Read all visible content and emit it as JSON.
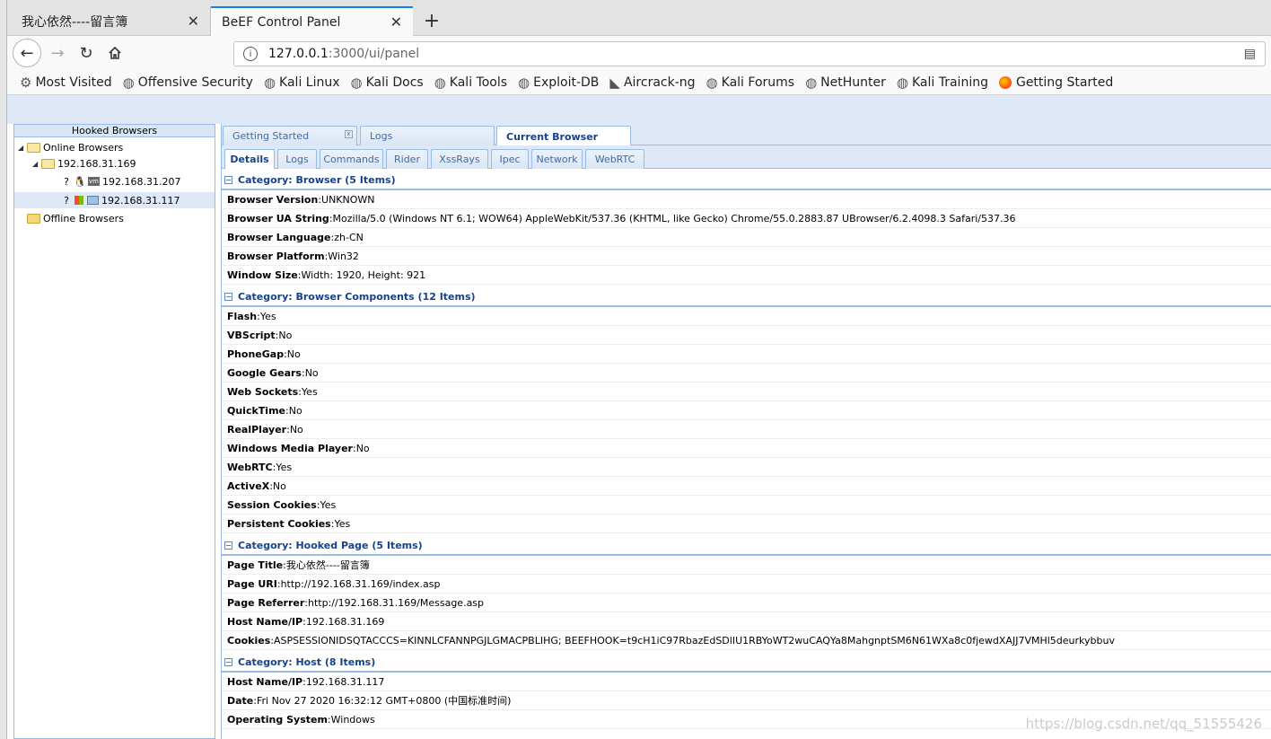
{
  "browser": {
    "tabs": [
      {
        "title": "我心依然----留言簿",
        "close": "✕"
      },
      {
        "title": "BeEF Control Panel",
        "close": "✕"
      }
    ],
    "new_tab": "+",
    "url_host": "127.0.0.1",
    "url_rest": ":3000/ui/panel",
    "bookmarks": [
      {
        "label": "Most Visited",
        "icon": "gear-icon"
      },
      {
        "label": "Offensive Security",
        "icon": "globe-icon"
      },
      {
        "label": "Kali Linux",
        "icon": "globe-icon"
      },
      {
        "label": "Kali Docs",
        "icon": "globe-icon"
      },
      {
        "label": "Kali Tools",
        "icon": "globe-icon"
      },
      {
        "label": "Exploit-DB",
        "icon": "globe-icon"
      },
      {
        "label": "Aircrack-ng",
        "icon": "aircrack-icon"
      },
      {
        "label": "Kali Forums",
        "icon": "globe-icon"
      },
      {
        "label": "NetHunter",
        "icon": "globe-icon"
      },
      {
        "label": "Kali Training",
        "icon": "globe-icon"
      },
      {
        "label": "Getting Started",
        "icon": "firefox-icon"
      }
    ]
  },
  "sidebar": {
    "title": "Hooked Browsers",
    "online": "Online Browsers",
    "host": "192.168.31.169",
    "clients": [
      "192.168.31.207",
      "192.168.31.117"
    ],
    "offline": "Offline Browsers",
    "unknown_mark": "?"
  },
  "top_tabs": [
    "Getting Started",
    "Logs",
    "Current Browser"
  ],
  "sub_tabs": [
    "Details",
    "Logs",
    "Commands",
    "Rider",
    "XssRays",
    "Ipec",
    "Network",
    "WebRTC"
  ],
  "categories": [
    {
      "title": "Category: Browser (5 Items)",
      "rows": [
        {
          "k": "Browser Version",
          "v": "UNKNOWN"
        },
        {
          "k": "Browser UA String",
          "v": "Mozilla/5.0 (Windows NT 6.1; WOW64) AppleWebKit/537.36 (KHTML, like Gecko) Chrome/55.0.2883.87 UBrowser/6.2.4098.3 Safari/537.36"
        },
        {
          "k": "Browser Language",
          "v": "zh-CN"
        },
        {
          "k": "Browser Platform",
          "v": "Win32"
        },
        {
          "k": "Window Size",
          "v": "Width: 1920, Height: 921"
        }
      ]
    },
    {
      "title": "Category: Browser Components (12 Items)",
      "rows": [
        {
          "k": "Flash",
          "v": "Yes"
        },
        {
          "k": "VBScript",
          "v": "No"
        },
        {
          "k": "PhoneGap",
          "v": "No"
        },
        {
          "k": "Google Gears",
          "v": "No"
        },
        {
          "k": "Web Sockets",
          "v": "Yes"
        },
        {
          "k": "QuickTime",
          "v": "No"
        },
        {
          "k": "RealPlayer",
          "v": "No"
        },
        {
          "k": "Windows Media Player",
          "v": "No"
        },
        {
          "k": "WebRTC",
          "v": "Yes"
        },
        {
          "k": "ActiveX",
          "v": "No"
        },
        {
          "k": "Session Cookies",
          "v": "Yes"
        },
        {
          "k": "Persistent Cookies",
          "v": "Yes"
        }
      ]
    },
    {
      "title": "Category: Hooked Page (5 Items)",
      "rows": [
        {
          "k": "Page Title",
          "v": "我心依然----留言簿"
        },
        {
          "k": "Page URI",
          "v": "http://192.168.31.169/index.asp"
        },
        {
          "k": "Page Referrer",
          "v": "http://192.168.31.169/Message.asp"
        },
        {
          "k": "Host Name/IP",
          "v": "192.168.31.169"
        },
        {
          "k": "Cookies",
          "v": "ASPSESSIONIDSQTACCCS=KINNLCFANNPGJLGMACPBLIHG; BEEFHOOK=t9cH1iC97RbazEdSDlIU1RBYoWT2wuCAQYa8MahgnptSM6N61WXa8c0fjewdXAJJ7VMHl5deurkybbuv"
        }
      ]
    },
    {
      "title": "Category: Host (8 Items)",
      "rows": [
        {
          "k": "Host Name/IP",
          "v": "192.168.31.117"
        },
        {
          "k": "Date",
          "v": "Fri Nov 27 2020 16:32:12 GMT+0800 (中国标准时间)"
        },
        {
          "k": "Operating System",
          "v": "Windows"
        }
      ]
    }
  ],
  "watermark": "https://blog.csdn.net/qq_51555426"
}
